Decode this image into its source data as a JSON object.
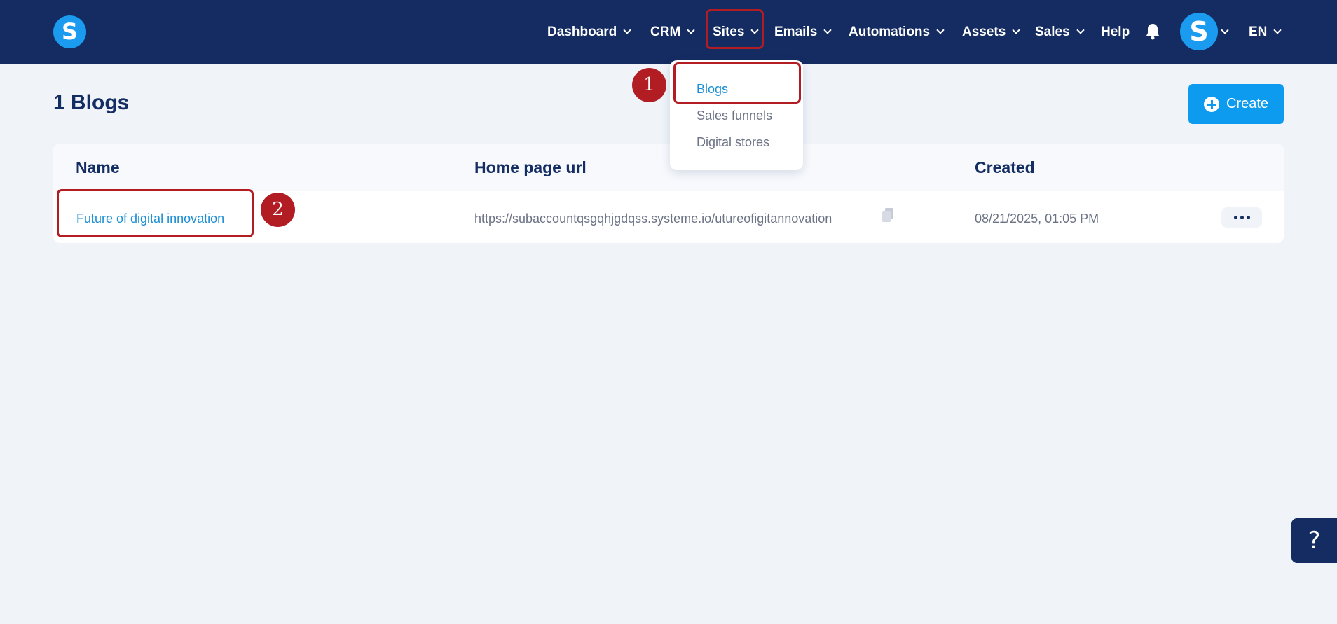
{
  "header": {
    "logo_letter": "S",
    "nav": [
      {
        "label": "Dashboard",
        "has_menu": true
      },
      {
        "label": "CRM",
        "has_menu": true
      },
      {
        "label": "Sites",
        "has_menu": true
      },
      {
        "label": "Emails",
        "has_menu": true
      },
      {
        "label": "Automations",
        "has_menu": true
      },
      {
        "label": "Assets",
        "has_menu": true
      },
      {
        "label": "Sales",
        "has_menu": true
      },
      {
        "label": "Help",
        "has_menu": false
      }
    ],
    "avatar_letter": "S",
    "language": "EN"
  },
  "sites_menu": {
    "items": [
      {
        "label": "Blogs",
        "active": true
      },
      {
        "label": "Sales funnels",
        "active": false
      },
      {
        "label": "Digital stores",
        "active": false
      }
    ]
  },
  "page": {
    "title": "1 Blogs",
    "create_label": "Create"
  },
  "table": {
    "columns": [
      "Name",
      "Home page url",
      "Created"
    ],
    "rows": [
      {
        "name": "Future of digital innovation",
        "url": "https://subaccountqsgqhjgdqss.systeme.io/utureofigitannovation",
        "created": "08/21/2025, 01:05 PM"
      }
    ]
  },
  "markers": [
    "1",
    "2"
  ],
  "help_label": "?",
  "colors": {
    "nav_bg": "#152c62",
    "accent": "#0d9bf0",
    "highlight": "#b21d24",
    "link": "#1b8fd3",
    "page_bg": "#f0f4f9"
  }
}
